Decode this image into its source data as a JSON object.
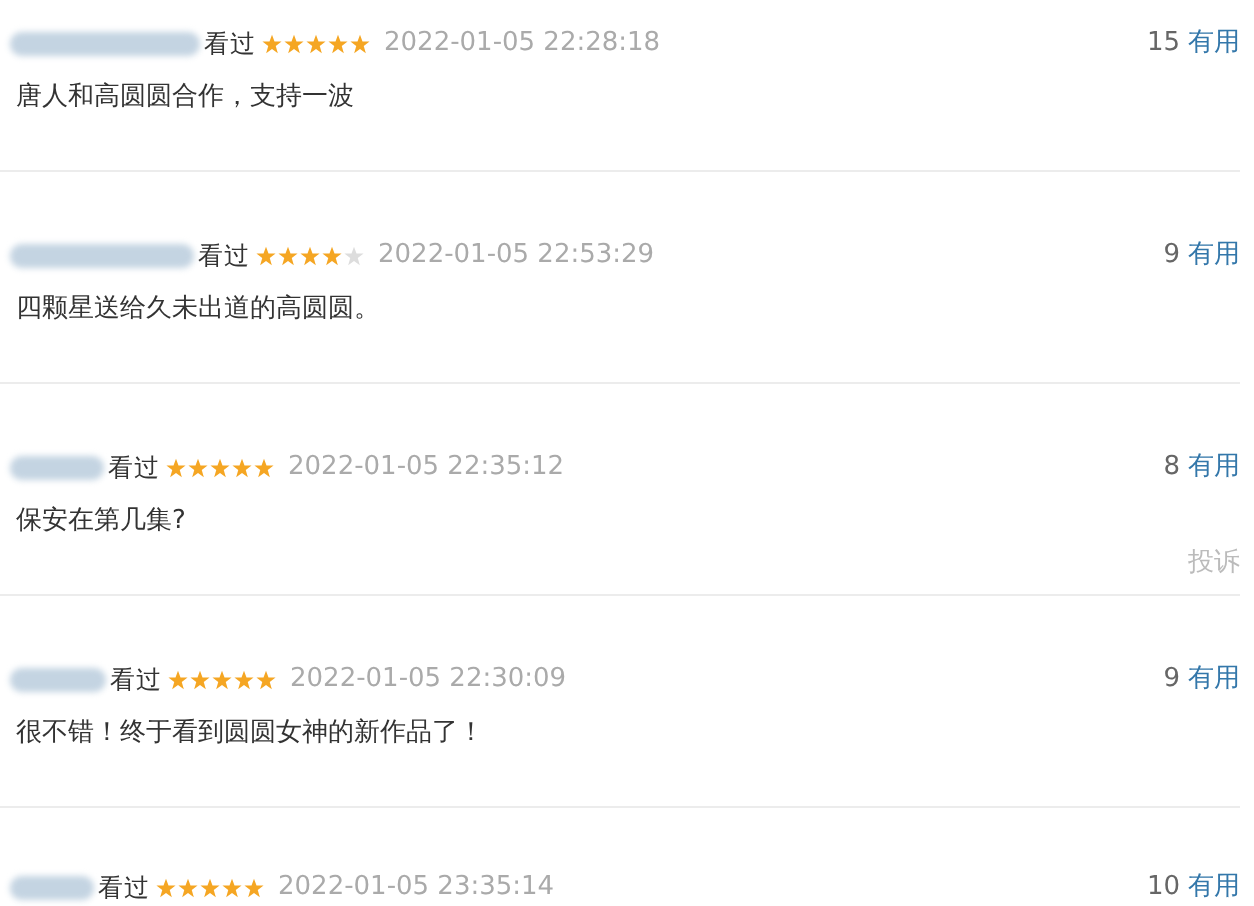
{
  "comments": [
    {
      "status": "看过",
      "stars": 5,
      "time": "2022-01-05 22:28:18",
      "votes": "15",
      "vote_label": "有用",
      "text": "唐人和高圆圆合作，支持一波"
    },
    {
      "status": "看过",
      "stars": 4,
      "time": "2022-01-05 22:53:29",
      "votes": "9",
      "vote_label": "有用",
      "text": "四颗星送给久未出道的高圆圆。"
    },
    {
      "status": "看过",
      "stars": 5,
      "time": "2022-01-05 22:35:12",
      "votes": "8",
      "vote_label": "有用",
      "text": "保安在第几集?",
      "report": "投诉"
    },
    {
      "status": "看过",
      "stars": 5,
      "time": "2022-01-05 22:30:09",
      "votes": "9",
      "vote_label": "有用",
      "text": "很不错！终于看到圆圆女神的新作品了！"
    },
    {
      "status": "看过",
      "stars": 5,
      "time": "2022-01-05 23:35:14",
      "votes": "10",
      "vote_label": "有用"
    }
  ]
}
